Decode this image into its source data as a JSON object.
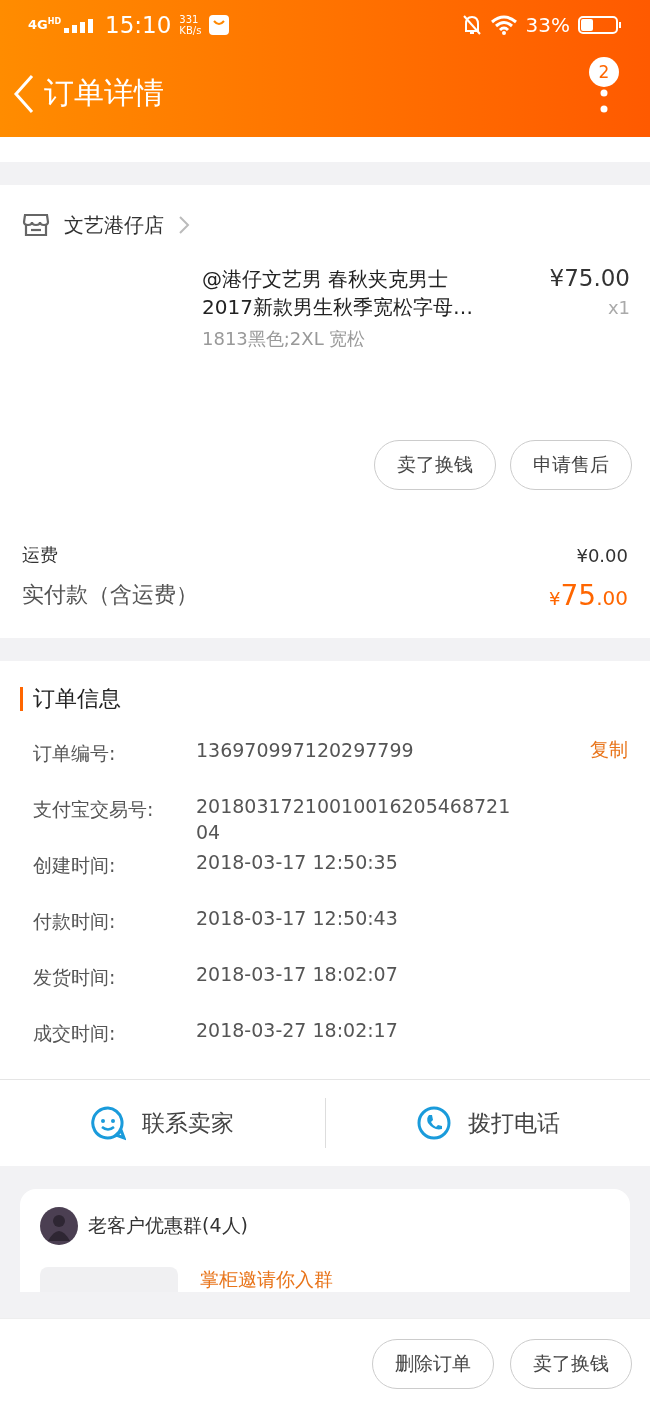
{
  "status_bar": {
    "network": "4G$^{HD}$",
    "time": "15:10",
    "speed_value": "331",
    "speed_unit": "KB/s",
    "battery": "33%"
  },
  "header": {
    "title": "订单详情",
    "badge": "2"
  },
  "shop": {
    "name": "文艺港仔店"
  },
  "item": {
    "title": "@港仔文艺男 春秋夹克男士2017新款男生秋季宽松字母…",
    "sku": "1813黑色;2XL 宽松",
    "price": "¥75.00",
    "quantity": "x1"
  },
  "item_actions": [
    "卖了换钱",
    "申请售后"
  ],
  "fees": [
    {
      "kind": "shipping",
      "label": "运费",
      "value": "¥0.00"
    },
    {
      "kind": "total",
      "label": "实付款（含运费）",
      "currency": "¥",
      "integer": "75",
      "decimal": ".00"
    }
  ],
  "order_info": {
    "title": "订单信息",
    "copy_label": "复制",
    "rows": [
      {
        "label": "订单编号:",
        "value": "136970997120297799"
      },
      {
        "label": "支付宝交易号:",
        "value": "2018031721001001620546872104"
      },
      {
        "label": "创建时间:",
        "value": "2018-03-17 12:50:35"
      },
      {
        "label": "付款时间:",
        "value": "2018-03-17 12:50:43"
      },
      {
        "label": "发货时间:",
        "value": "2018-03-17 18:02:07"
      },
      {
        "label": "成交时间:",
        "value": "2018-03-27 18:02:17"
      }
    ]
  },
  "contact_bar": [
    {
      "kind": "chat",
      "label": "联系卖家"
    },
    {
      "kind": "phone",
      "label": "拨打电话"
    }
  ],
  "group_card": {
    "name": "老客户优惠群(4人)",
    "message": "掌柜邀请你入群"
  },
  "bottom_actions": [
    "删除订单",
    "卖了换钱"
  ]
}
